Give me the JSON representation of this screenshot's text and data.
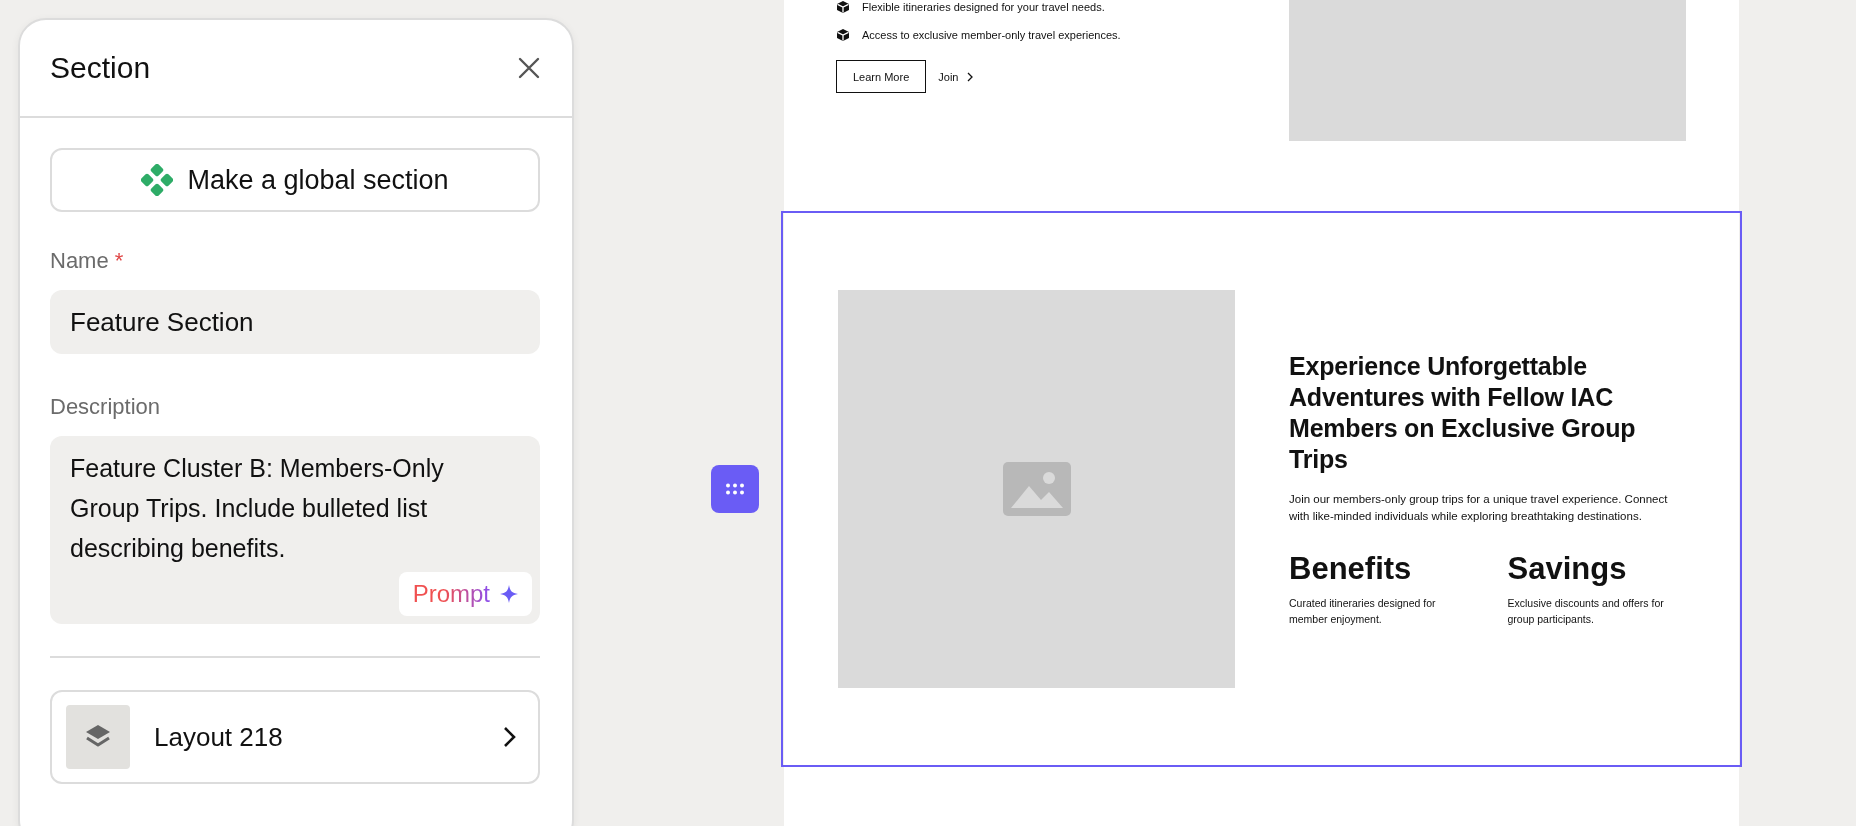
{
  "panel": {
    "title": "Section",
    "global_button": "Make a global section",
    "name_field": {
      "label": "Name",
      "required_mark": "*",
      "value": "Feature Section"
    },
    "description_field": {
      "label": "Description",
      "value": "Feature Cluster B: Members-Only Group Trips. Include bulleted list describing benefits.",
      "prompt_button": "Prompt"
    },
    "layout": {
      "label": "Layout 218"
    }
  },
  "page": {
    "top_section": {
      "bullets": [
        "Flexible itineraries designed for your travel needs.",
        "Access to exclusive member-only travel experiences."
      ],
      "buttons": [
        {
          "label": "Learn More",
          "kind": "outline"
        },
        {
          "label": "Join",
          "kind": "link"
        }
      ]
    },
    "feature_section": {
      "selected": true,
      "heading": "Experience Unforgettable Adventures with Fellow IAC Members on Exclusive Group Trips",
      "body": "Join our members-only group trips for a unique travel experience. Connect with like-minded individuals while exploring breathtaking destinations.",
      "features": [
        {
          "title": "Benefits",
          "text": "Curated itineraries designed for member enjoyment."
        },
        {
          "title": "Savings",
          "text": "Exclusive discounts and offers for group participants."
        }
      ]
    }
  }
}
